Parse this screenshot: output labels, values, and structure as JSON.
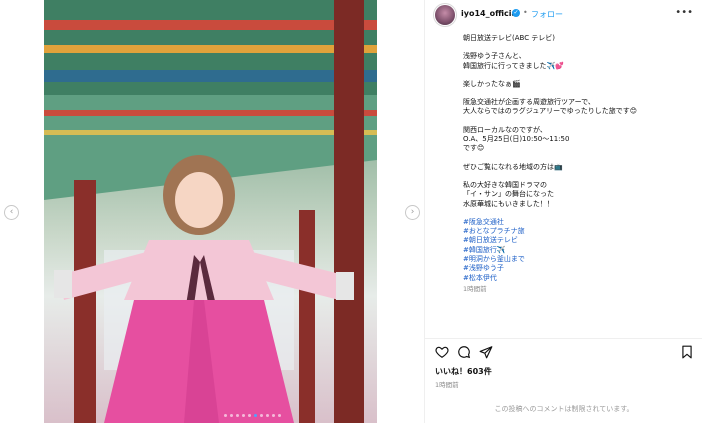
{
  "post": {
    "username": "iyo14_official",
    "follow_label": "フォロー",
    "bullet": "•",
    "caption_lines": [
      "朝日放送テレビ(ABC テレビ)",
      "",
      "浅野ゆう子さんと、",
      "韓国旅行に行ってきました✈️💕",
      "",
      "楽しかったなぁ🎬",
      "",
      "阪急交通社が企画する周遊旅行ツアーで、",
      "大人ならではのラグジュアリーでゆったりした旅です😊",
      "",
      "関西ローカルなのですが、",
      "O.A、5月25日(日)10:50〜11:50",
      "です😊",
      "",
      "ぜひご覧になれる地域の方は📺",
      "",
      "私の大好きな韓国ドラマの",
      "「イ・サン」の舞台になった",
      "水原華城にもいきました！！"
    ],
    "hashtags": [
      "#阪急交通社",
      "#おとなプラチナ旅",
      "#朝日放送テレビ",
      "#韓国旅行✈️",
      "#明洞から釜山まで",
      "#浅野ゆう子",
      "#松本伊代"
    ],
    "caption_time": "1時間前",
    "likes": "いいね！603件",
    "time_ago": "1時間前",
    "comments_closed": "この投稿へのコメントは制限されています。"
  },
  "carousel": {
    "prev_icon": "‹",
    "next_icon": "›",
    "slide_count": 10,
    "active_index": 5
  },
  "colors": {
    "link": "#1d9bf0",
    "hashtag": "#1d5fc7",
    "hanbok_pink": "#e64fa0"
  }
}
